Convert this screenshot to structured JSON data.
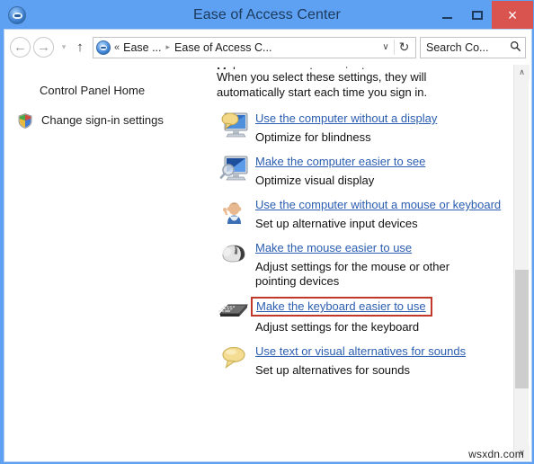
{
  "window": {
    "title": "Ease of Access Center",
    "title_icon": "ease-of-access-icon",
    "minimize_label": "–",
    "maximize_label": "",
    "close_label": "×"
  },
  "navbar": {
    "back_label": "←",
    "forward_label": "→",
    "history_label": "▾",
    "up_label": "↑",
    "address": {
      "icon": "ease-of-access-icon",
      "overflow": "«",
      "crumb1": "Ease ...",
      "separator": "▸",
      "crumb2": "Ease of Access C...",
      "dropdown_label": "∨",
      "refresh_label": "↻"
    },
    "search": {
      "text": "Search Co...",
      "icon": "search-icon"
    }
  },
  "sidebar": {
    "items": [
      {
        "label": "Control Panel Home",
        "icon": null
      },
      {
        "label": "Change sign-in settings",
        "icon": "shield-icon"
      }
    ]
  },
  "content": {
    "intro_cut": "Make your computer easier to use",
    "intro_line1": "When you select these settings, they will",
    "intro_line2": "automatically start each time you sign in.",
    "items": [
      {
        "icon": "monitor-speech-bubble-icon",
        "link": "Use the computer without a display",
        "desc": "Optimize for blindness",
        "highlighted": false
      },
      {
        "icon": "monitor-magnifier-icon",
        "link": "Make the computer easier to see",
        "desc": "Optimize visual display",
        "highlighted": false
      },
      {
        "icon": "person-waving-icon",
        "link": "Use the computer without a mouse or keyboard",
        "desc": "Set up alternative input devices",
        "highlighted": false
      },
      {
        "icon": "mouse-icon",
        "link": "Make the mouse easier to use",
        "desc": "Adjust settings for the mouse or other pointing devices",
        "highlighted": false
      },
      {
        "icon": "keyboard-icon",
        "link": "Make the keyboard easier to use",
        "desc": "Adjust settings for the keyboard",
        "highlighted": true
      },
      {
        "icon": "speech-bubble-icon",
        "link": "Use text or visual alternatives for sounds",
        "desc": "Set up alternatives for sounds",
        "highlighted": false
      }
    ]
  },
  "scrollbar": {
    "up_label": "∧",
    "down_label": "∨"
  },
  "watermark": "wsxdn.com",
  "colors": {
    "titlebar": "#5ea0f2",
    "close_button": "#d9534f",
    "link": "#2a5db0",
    "highlight_box": "#c0392b",
    "scrollbar_thumb": "#cdcdcd"
  }
}
